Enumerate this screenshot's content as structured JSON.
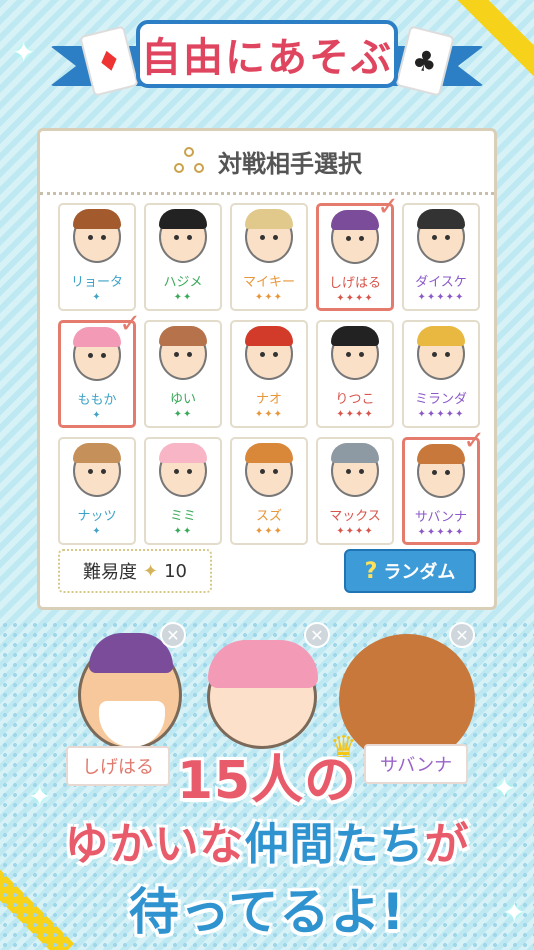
{
  "title": "自由にあそぶ",
  "banner_cards": {
    "left": "♦",
    "right": "♣"
  },
  "panel": {
    "heading": "対戦相手選択",
    "difficulty_label": "難易度",
    "difficulty_value": "10",
    "random_label": "ランダム",
    "random_icon": "?"
  },
  "opponents": [
    {
      "name": "リョータ",
      "stars": "✦",
      "level": 1,
      "selected": false,
      "hair": "#a35a2d",
      "color": "blue"
    },
    {
      "name": "ハジメ",
      "stars": "✦✦",
      "level": 2,
      "selected": false,
      "hair": "#222",
      "color": "green"
    },
    {
      "name": "マイキー",
      "stars": "✦✦✦",
      "level": 3,
      "selected": false,
      "hair": "#e0c98a",
      "color": "orange"
    },
    {
      "name": "しげはる",
      "stars": "✦✦✦✦",
      "level": 4,
      "selected": true,
      "hair": "#7a4c9a",
      "color": "red"
    },
    {
      "name": "ダイスケ",
      "stars": "✦✦✦✦✦",
      "level": 5,
      "selected": false,
      "hair": "#333",
      "color": "purple"
    },
    {
      "name": "ももか",
      "stars": "✦",
      "level": 1,
      "selected": true,
      "hair": "#f39ab6",
      "color": "blue"
    },
    {
      "name": "ゆい",
      "stars": "✦✦",
      "level": 2,
      "selected": false,
      "hair": "#b6724b",
      "color": "green"
    },
    {
      "name": "ナオ",
      "stars": "✦✦✦",
      "level": 3,
      "selected": false,
      "hair": "#d23b2a",
      "color": "orange"
    },
    {
      "name": "りつこ",
      "stars": "✦✦✦✦",
      "level": 4,
      "selected": false,
      "hair": "#222",
      "color": "red"
    },
    {
      "name": "ミランダ",
      "stars": "✦✦✦✦✦",
      "level": 5,
      "selected": false,
      "hair": "#e8b840",
      "color": "purple"
    },
    {
      "name": "ナッツ",
      "stars": "✦",
      "level": 1,
      "selected": false,
      "hair": "#c6905a",
      "color": "blue"
    },
    {
      "name": "ミミ",
      "stars": "✦✦",
      "level": 2,
      "selected": false,
      "hair": "#f7b5c6",
      "color": "green"
    },
    {
      "name": "スズ",
      "stars": "✦✦✦",
      "level": 3,
      "selected": false,
      "hair": "#d9883a",
      "color": "orange"
    },
    {
      "name": "マックス",
      "stars": "✦✦✦✦",
      "level": 4,
      "selected": false,
      "hair": "#8d99a3",
      "color": "red"
    },
    {
      "name": "サバンナ",
      "stars": "✦✦✦✦✦",
      "level": 5,
      "selected": true,
      "hair": "#c8783a",
      "color": "purple"
    }
  ],
  "selected_tags": {
    "left": "しげはる",
    "right": "サバンナ"
  },
  "remove_icon": "✕",
  "check_icon": "✓",
  "tagline": {
    "line1": "15人の",
    "line2_a": "ゆかいな",
    "line2_b": "仲間たち",
    "line2_c": "が",
    "line3": "待ってるよ!"
  },
  "colors": {
    "accent": "#e85b6b",
    "blue": "#2f93d0",
    "panel_border": "#d9cfb8",
    "select": "#e57b6d"
  }
}
